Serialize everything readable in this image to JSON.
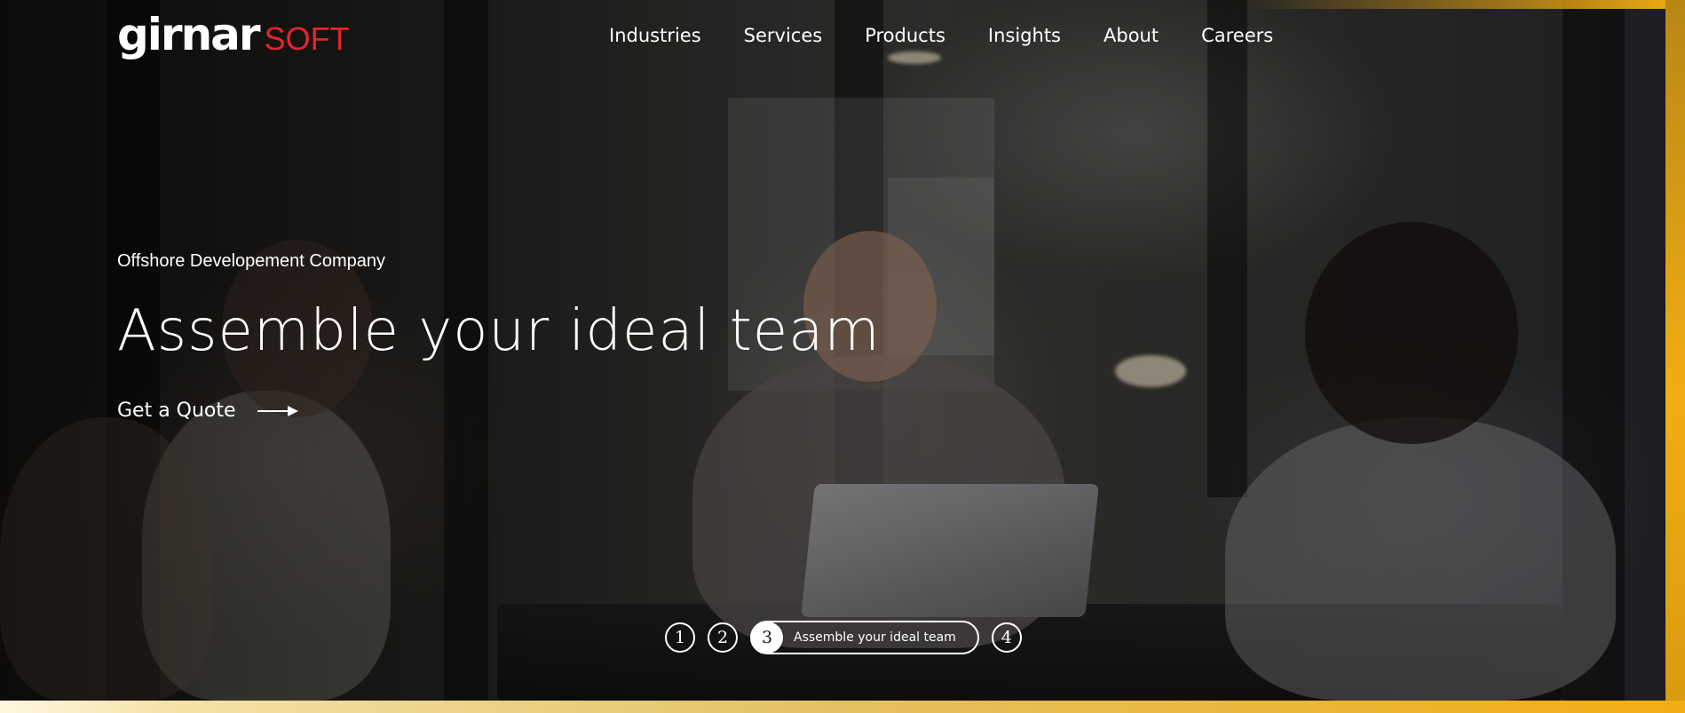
{
  "brand": {
    "logo_main": "girnar",
    "logo_sub": "SOFT",
    "accent_color": "#e3252b",
    "frame_color": "#f2ad14"
  },
  "nav": {
    "items": [
      {
        "label": "Industries"
      },
      {
        "label": "Services"
      },
      {
        "label": "Products"
      },
      {
        "label": "Insights"
      },
      {
        "label": "About"
      },
      {
        "label": "Careers"
      }
    ]
  },
  "hero": {
    "eyebrow": "Offshore Developement Company",
    "headline": "Assemble your ideal team",
    "cta_label": "Get a Quote",
    "cta_icon": "arrow-right-icon"
  },
  "slider": {
    "slides": [
      {
        "number": "1"
      },
      {
        "number": "2"
      },
      {
        "number": "3",
        "title": "Assemble your ideal team",
        "active": true
      },
      {
        "number": "4"
      }
    ]
  }
}
